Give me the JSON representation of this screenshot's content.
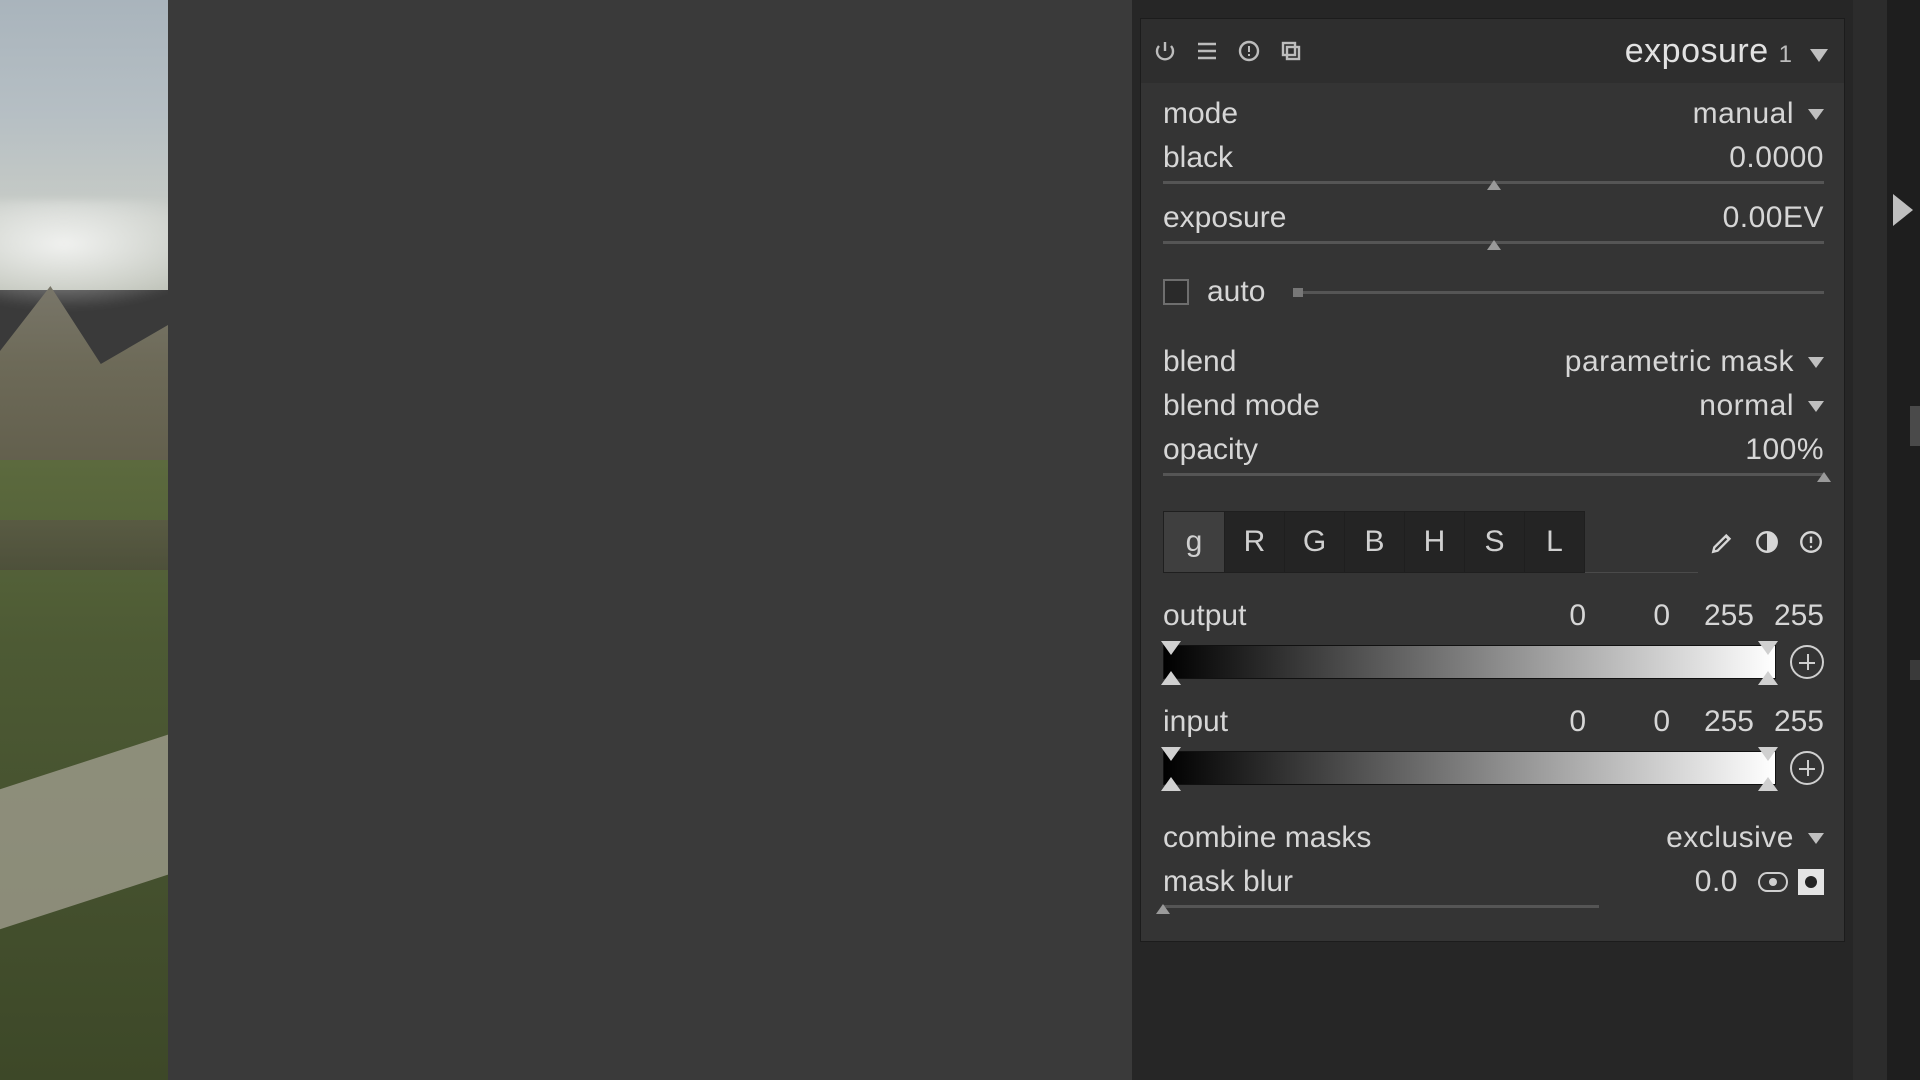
{
  "module": {
    "title": "exposure",
    "instance": "1",
    "mode": {
      "label": "mode",
      "value": "manual"
    },
    "black": {
      "label": "black",
      "value": "0.0000",
      "slider_pos": 0.5
    },
    "exposure": {
      "label": "exposure",
      "value": "0.00EV",
      "slider_pos": 0.5
    },
    "auto": {
      "label": "auto",
      "checked": false
    },
    "blend": {
      "label": "blend",
      "value": "parametric mask"
    },
    "blend_mode": {
      "label": "blend mode",
      "value": "normal"
    },
    "opacity": {
      "label": "opacity",
      "value": "100%",
      "slider_pos": 1.0
    },
    "channels": [
      "g",
      "R",
      "G",
      "B",
      "H",
      "S",
      "L"
    ],
    "channel_selected": "g",
    "output": {
      "label": "output",
      "v0": "0",
      "v1": "0",
      "v2": "255",
      "v3": "255"
    },
    "input": {
      "label": "input",
      "v0": "0",
      "v1": "0",
      "v2": "255",
      "v3": "255"
    },
    "combine": {
      "label": "combine masks",
      "value": "exclusive"
    },
    "mask_blur": {
      "label": "mask blur",
      "value": "0.0",
      "slider_pos": 0.0
    }
  }
}
